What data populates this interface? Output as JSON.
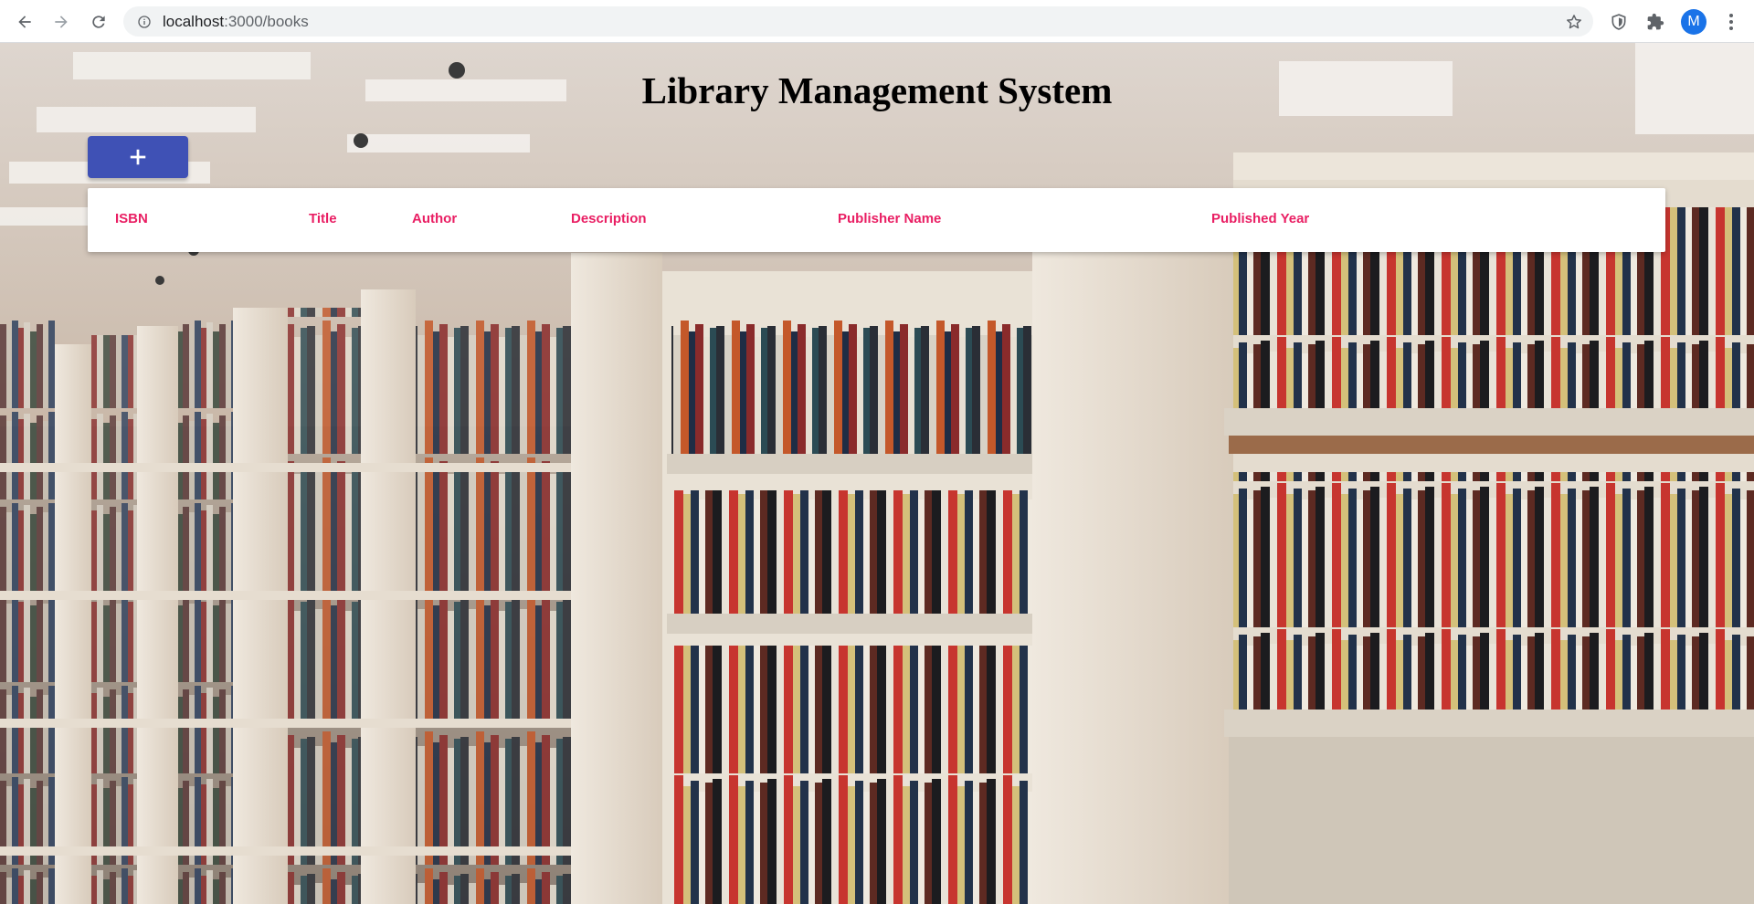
{
  "browser": {
    "url_host": "localhost",
    "url_path": ":3000/books",
    "profile_initial": "M",
    "icons": {
      "back": "back-arrow-icon",
      "forward": "forward-arrow-icon",
      "reload": "reload-icon",
      "info": "info-icon",
      "bookmark": "star-icon",
      "extension_shield": "shield-icon",
      "extensions": "puzzle-icon",
      "menu": "kebab-menu-icon"
    }
  },
  "app": {
    "title": "Library Management System",
    "add_button_icon": "plus-icon",
    "accent_color": "#3f51b5",
    "header_text_color": "#e91e63"
  },
  "table": {
    "columns": [
      "ISBN",
      "Title",
      "Author",
      "Description",
      "Publisher Name",
      "Published Year"
    ],
    "rows": []
  }
}
